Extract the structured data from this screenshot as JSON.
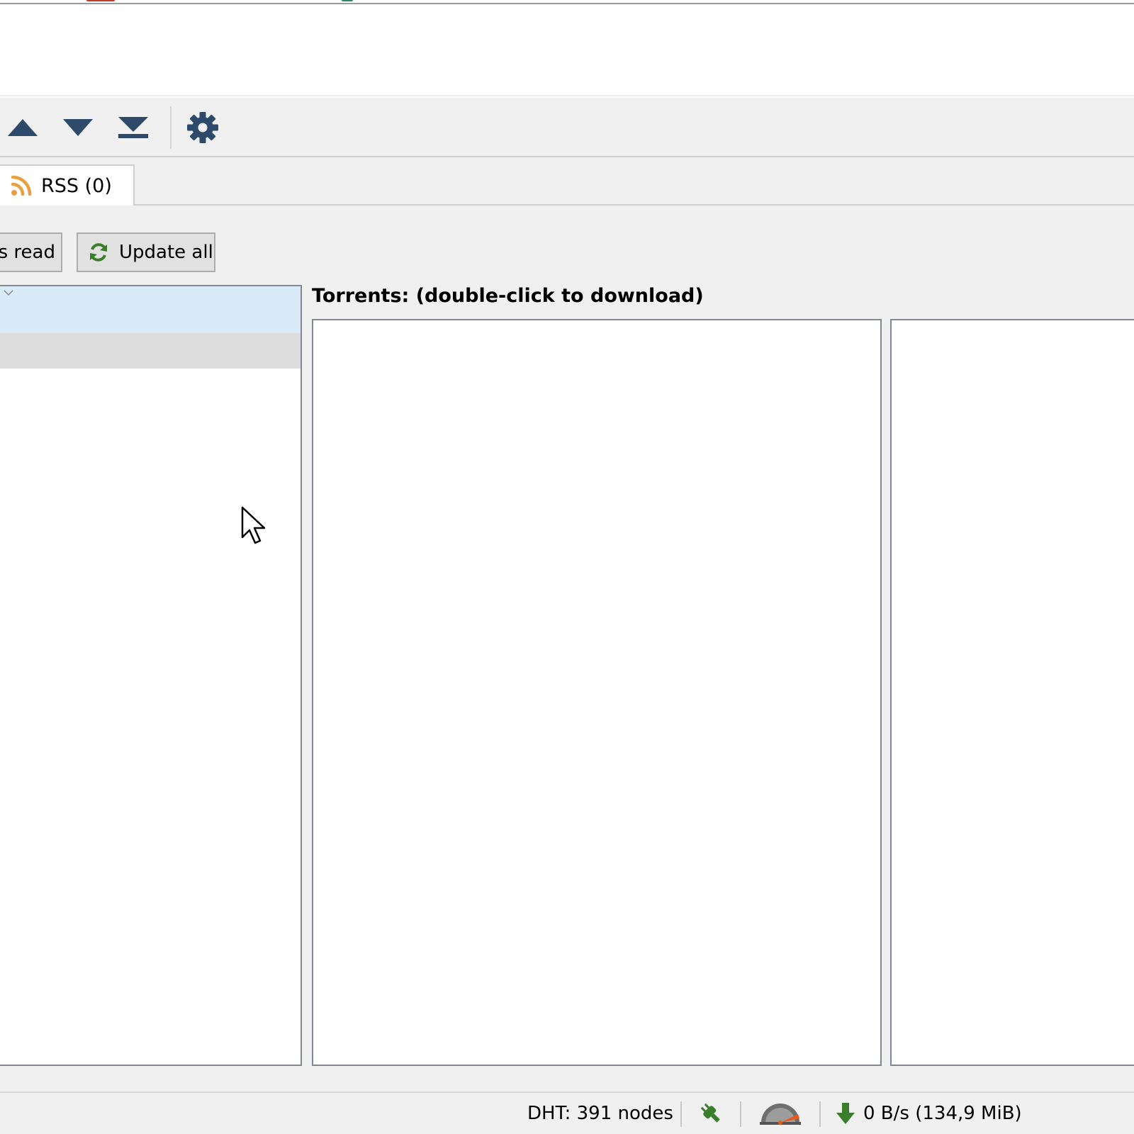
{
  "tabs": [
    {
      "label": "RSS (0)",
      "icon": "rss-icon"
    }
  ],
  "toolbar": {
    "buttons": [
      {
        "name": "move-up-button",
        "icon": "triangle-up-icon"
      },
      {
        "name": "move-down-button",
        "icon": "triangle-down-icon"
      },
      {
        "name": "move-bottom-button",
        "icon": "move-to-bottom-icon"
      },
      {
        "name": "options-button",
        "icon": "gear-icon"
      }
    ],
    "icon_color": "#2d4a6b"
  },
  "rss": {
    "mark_read_label": "s read",
    "update_all_label": "Update all",
    "torrents_label": "Torrents: (double-click to download)"
  },
  "status": {
    "dht": "DHT: 391 nodes",
    "download": "0 B/s (134,9 MiB)"
  },
  "colors": {
    "accent_green": "#3a7d2a",
    "rss_orange": "#e8a040",
    "selection": "#d9ebf9"
  }
}
